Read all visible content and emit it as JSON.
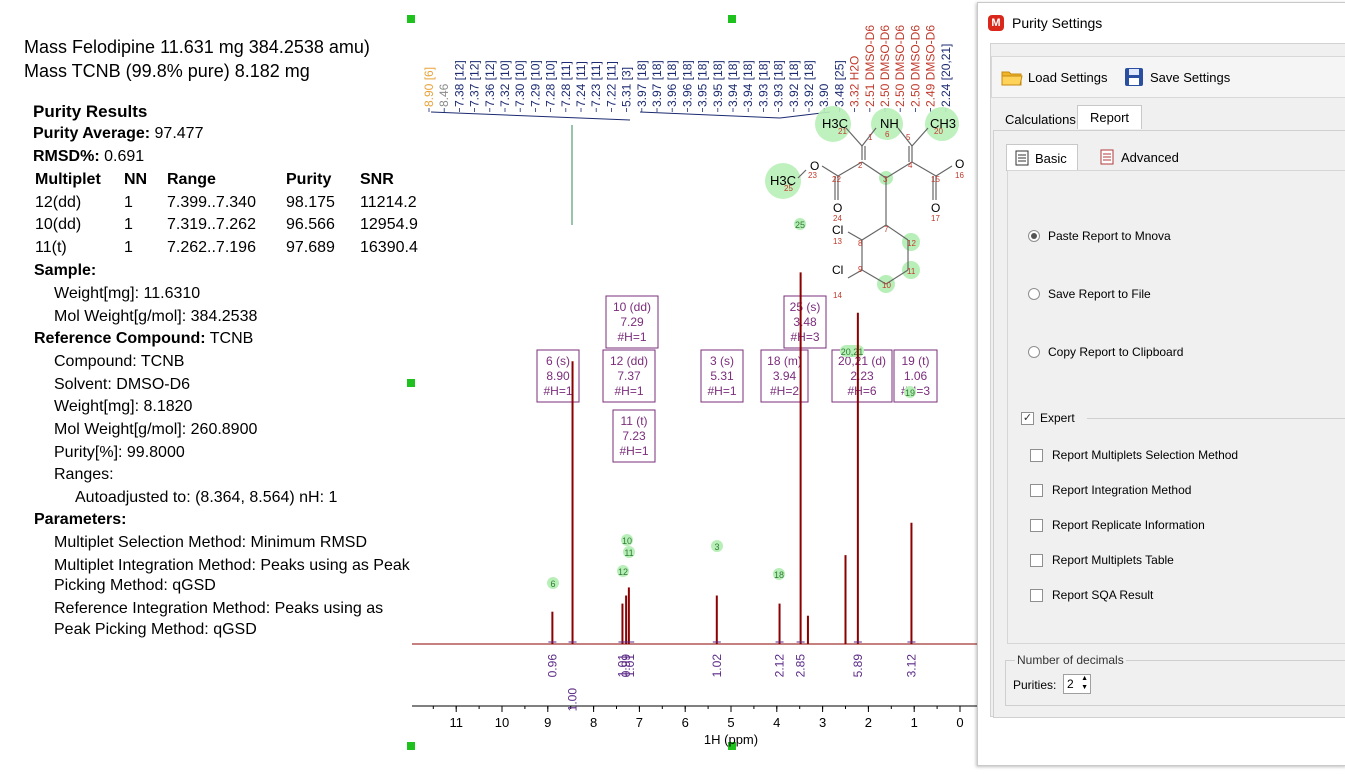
{
  "header": {
    "line1": "Mass Felodipine 11.631 mg 384.2538 amu)",
    "line2": "Mass TCNB (99.8% pure) 8.182 mg"
  },
  "results": {
    "title": "Purity Results",
    "purity_average_label": "Purity Average:",
    "purity_average_value": "97.477",
    "rmsd_label": "RMSD%:",
    "rmsd_value": "0.691",
    "columns": [
      "Multiplet",
      "NN",
      "Range",
      "Purity",
      "SNR"
    ],
    "rows": [
      [
        "12(dd)",
        "1",
        "7.399..7.340",
        "98.175",
        "11214.2"
      ],
      [
        "10(dd)",
        "1",
        "7.319..7.262",
        "96.566",
        "12954.9"
      ],
      [
        "11(t)",
        "1",
        "7.262..7.196",
        "97.689",
        "16390.4"
      ]
    ],
    "sample_label": "Sample:",
    "sample_weight": "Weight[mg]: 11.6310",
    "sample_molweight": "Mol Weight[g/mol]: 384.2538",
    "reference_label": "Reference Compound:",
    "reference_value": "TCNB",
    "ref_compound": "Compound: TCNB",
    "ref_solvent": "Solvent: DMSO-D6",
    "ref_weight": "Weight[mg]: 8.1820",
    "ref_molweight": "Mol Weight[g/mol]: 260.8900",
    "ref_purity": "Purity[%]: 99.8000",
    "ref_ranges": "Ranges:",
    "ref_autoadjusted": "Autoadjusted to: (8.364, 8.564) nH: 1",
    "parameters_label": "Parameters:",
    "param_selection": "Multiplet Selection Method: Minimum RMSD",
    "param_integration_1": "Multiplet Integration Method: Peaks using as Peak",
    "param_integration_2": "Picking Method: qGSD",
    "param_ref_integration_1": "Reference Integration Method: Peaks using as",
    "param_ref_integration_2": "Peak Picking Method: qGSD"
  },
  "chart_data": {
    "type": "line",
    "xlabel": "1H (ppm)",
    "xlim": [
      12,
      0
    ],
    "x_ticks": [
      "11",
      "10",
      "9",
      "8",
      "7",
      "6",
      "5",
      "4",
      "3",
      "2",
      "1",
      "0"
    ],
    "spectrum_color": "#8b0000",
    "peaks": [
      {
        "x": 8.9,
        "height": 0.08
      },
      {
        "x": 8.46,
        "height": 0.7
      },
      {
        "x": 7.37,
        "height": 0.1
      },
      {
        "x": 7.29,
        "height": 0.12
      },
      {
        "x": 7.23,
        "height": 0.14
      },
      {
        "x": 5.31,
        "height": 0.12
      },
      {
        "x": 3.94,
        "height": 0.1
      },
      {
        "x": 3.48,
        "height": 0.92
      },
      {
        "x": 3.32,
        "height": 0.07
      },
      {
        "x": 2.5,
        "height": 0.22
      },
      {
        "x": 2.23,
        "height": 0.82
      },
      {
        "x": 1.06,
        "height": 0.3
      }
    ],
    "integrals": [
      {
        "x": 8.9,
        "label": "0.96"
      },
      {
        "x": 8.46,
        "label": "1.00"
      },
      {
        "x": 7.37,
        "label": "1.01"
      },
      {
        "x": 7.29,
        "label": "0.99"
      },
      {
        "x": 7.2,
        "label": "1.01"
      },
      {
        "x": 5.31,
        "label": "1.02"
      },
      {
        "x": 3.94,
        "label": "2.12"
      },
      {
        "x": 3.48,
        "label": "2.85"
      },
      {
        "x": 2.23,
        "label": "5.89"
      },
      {
        "x": 1.06,
        "label": "3.12"
      }
    ],
    "peak_labels_top": [
      {
        "label": "8.90 [6]",
        "color": "#e8a33a"
      },
      {
        "label": "8.46",
        "color": "#8a8a8a"
      },
      {
        "label": "7.38 [12]",
        "color": "#1b2a70"
      },
      {
        "label": "7.37 [12]",
        "color": "#1b2a70"
      },
      {
        "label": "7.36 [12]",
        "color": "#1b2a70"
      },
      {
        "label": "7.32 [10]",
        "color": "#1b2a70"
      },
      {
        "label": "7.30 [10]",
        "color": "#1b2a70"
      },
      {
        "label": "7.29 [10]",
        "color": "#1b2a70"
      },
      {
        "label": "7.28 [10]",
        "color": "#1b2a70"
      },
      {
        "label": "7.28 [11]",
        "color": "#1b2a70"
      },
      {
        "label": "7.24 [11]",
        "color": "#1b2a70"
      },
      {
        "label": "7.23 [11]",
        "color": "#1b2a70"
      },
      {
        "label": "7.22 [11]",
        "color": "#1b2a70"
      },
      {
        "label": "5.31 [3]",
        "color": "#1b2a70"
      },
      {
        "label": "3.97 [18]",
        "color": "#1b2a70"
      },
      {
        "label": "3.97 [18]",
        "color": "#1b2a70"
      },
      {
        "label": "3.96 [18]",
        "color": "#1b2a70"
      },
      {
        "label": "3.96 [18]",
        "color": "#1b2a70"
      },
      {
        "label": "3.95 [18]",
        "color": "#1b2a70"
      },
      {
        "label": "3.95 [18]",
        "color": "#1b2a70"
      },
      {
        "label": "3.94 [18]",
        "color": "#1b2a70"
      },
      {
        "label": "3.94 [18]",
        "color": "#1b2a70"
      },
      {
        "label": "3.93 [18]",
        "color": "#1b2a70"
      },
      {
        "label": "3.93 [18]",
        "color": "#1b2a70"
      },
      {
        "label": "3.92 [18]",
        "color": "#1b2a70"
      },
      {
        "label": "3.92 [18]",
        "color": "#1b2a70"
      },
      {
        "label": "3.90",
        "color": "#1b2a70"
      },
      {
        "label": "3.48 [25]",
        "color": "#1b2a70"
      },
      {
        "label": "3.32 H2O",
        "color": "#c0392b"
      },
      {
        "label": "2.51 DMSO-D6",
        "color": "#c0392b"
      },
      {
        "label": "2.50 DMSO-D6",
        "color": "#c0392b"
      },
      {
        "label": "2.50 DMSO-D6",
        "color": "#c0392b"
      },
      {
        "label": "2.50 DMSO-D6",
        "color": "#c0392b"
      },
      {
        "label": "2.49 DMSO-D6",
        "color": "#c0392b"
      },
      {
        "label": "2.24 [20,21]",
        "color": "#1b2a70"
      }
    ],
    "multiplet_boxes": [
      {
        "lines": [
          "6 (s)",
          "8.90",
          "#H=1"
        ]
      },
      {
        "lines": [
          "10 (dd)",
          "7.29",
          "#H=1"
        ]
      },
      {
        "lines": [
          "12 (dd)",
          "7.37",
          "#H=1"
        ]
      },
      {
        "lines": [
          "11 (t)",
          "7.23",
          "#H=1"
        ]
      },
      {
        "lines": [
          "3 (s)",
          "5.31",
          "#H=1"
        ]
      },
      {
        "lines": [
          "18 (m)",
          "3.94",
          "#H=2"
        ]
      },
      {
        "lines": [
          "25 (s)",
          "3.48",
          "#H=3"
        ]
      },
      {
        "lines": [
          "20,21 (d)",
          "2.23",
          "#H=6"
        ]
      },
      {
        "lines": [
          "19 (t)",
          "1.06",
          "#H=3"
        ]
      }
    ],
    "peak_assignment_labels": [
      "6",
      "12",
      "10",
      "11",
      "3",
      "18",
      "20,21",
      "19",
      "25"
    ]
  },
  "molecule": {
    "labels": [
      "H3C",
      "21",
      "NH",
      "6",
      "CH3",
      "20",
      "1",
      "2",
      "3",
      "4",
      "5",
      "O",
      "23",
      "H3C",
      "25",
      "22",
      "O",
      "24",
      "15",
      "O",
      "16",
      "O",
      "17",
      "7",
      "8",
      "9",
      "10",
      "11",
      "12",
      "Cl",
      "13",
      "Cl",
      "14"
    ]
  },
  "dialog": {
    "title": "Purity Settings",
    "load_settings": "Load Settings",
    "save_settings": "Save Settings",
    "tabs": [
      "Calculations",
      "Report"
    ],
    "active_tab": "Report",
    "subtabs": [
      "Basic",
      "Advanced"
    ],
    "radio_options": [
      "Paste Report to Mnova",
      "Save Report to File",
      "Copy Report to Clipboard"
    ],
    "selected_radio": "Paste Report to Mnova",
    "expert_label": "Expert",
    "expert_checked": true,
    "expert_options": [
      "Report Multiplets Selection Method",
      "Report Integration Method",
      "Report Replicate Information",
      "Report Multiplets Table",
      "Report SQA Result"
    ],
    "decimals_group": "Number of decimals",
    "purities_label": "Purities:",
    "purities_value": "2"
  }
}
